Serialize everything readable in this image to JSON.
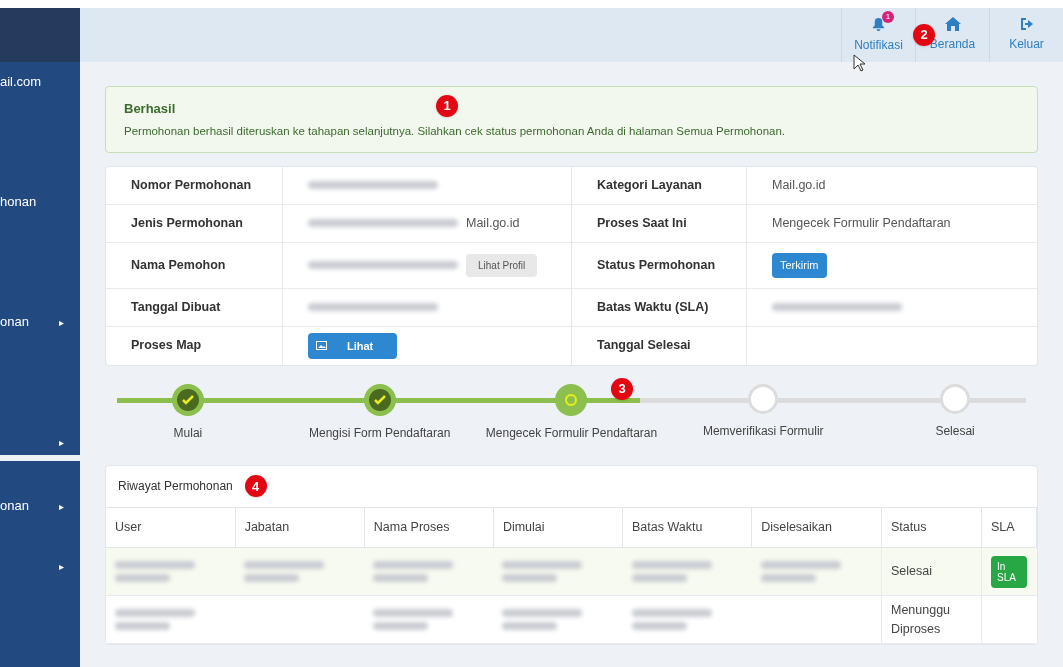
{
  "sidebar": {
    "items": [
      {
        "label": "ail.com",
        "arrow": false
      },
      {
        "label": "honan",
        "arrow": false
      },
      {
        "label": "onan",
        "arrow": true
      },
      {
        "arrow": true
      }
    ],
    "lower_items": [
      {
        "label": "onan",
        "arrow": true
      },
      {
        "arrow": true
      }
    ],
    "arrow_glyph": "▸"
  },
  "header": {
    "actions": [
      {
        "label": "Notifikasi",
        "kind": "bell",
        "badge": "1"
      },
      {
        "label": "Beranda",
        "kind": "home"
      },
      {
        "label": "Keluar",
        "kind": "logout"
      }
    ]
  },
  "alert": {
    "title": "Berhasil",
    "message": "Permohonan berhasil diteruskan ke tahapan selanjutnya. Silahkan cek status permohonan Anda di halaman Semua Permohonan."
  },
  "details": {
    "left": [
      {
        "label": "Nomor Permohonan",
        "kind": "blurred"
      },
      {
        "label": "Jenis Permohonan",
        "kind": "blurred_text",
        "value": "Mail.go.id"
      },
      {
        "label": "Nama Pemohon",
        "kind": "blurred_button",
        "button": "Lihat Profil"
      },
      {
        "label": "Tanggal Dibuat",
        "kind": "blurred"
      },
      {
        "label": "Proses Map",
        "kind": "image_button",
        "button": "Lihat"
      }
    ],
    "right": [
      {
        "label": "Kategori Layanan",
        "kind": "text",
        "value": "Mail.go.id"
      },
      {
        "label": "Proses Saat Ini",
        "kind": "text",
        "value": "Mengecek Formulir Pendaftaran"
      },
      {
        "label": "Status Permohonan",
        "kind": "badge",
        "value": "Terkirim"
      },
      {
        "label": "Batas Waktu (SLA)",
        "kind": "blurred"
      },
      {
        "label": "Tanggal Selesai",
        "kind": "empty"
      }
    ]
  },
  "steps": [
    {
      "label": "Mulai",
      "done": true,
      "current": false
    },
    {
      "label": "Mengisi Form Pendaftaran",
      "done": true,
      "current": false
    },
    {
      "label": "Mengecek Formulir Pendaftaran",
      "done": false,
      "current": true
    },
    {
      "label": "Memverifikasi Formulir",
      "done": false,
      "current": false
    },
    {
      "label": "Selesai",
      "done": false,
      "current": false
    }
  ],
  "history": {
    "title": "Riwayat Permohonan",
    "columns": [
      "User",
      "Jabatan",
      "Nama Proses",
      "Dimulai",
      "Batas Waktu",
      "Diselesaikan",
      "Status",
      "SLA"
    ],
    "rows": [
      {
        "highlight": true,
        "cells": [
          true,
          true,
          true,
          true,
          true,
          true
        ],
        "status": "Selesai",
        "sla": "In SLA"
      },
      {
        "highlight": false,
        "cells": [
          true,
          false,
          true,
          true,
          true,
          false
        ],
        "status": "Menunggu Diproses"
      }
    ]
  },
  "markers": [
    "1",
    "2",
    "3",
    "4"
  ]
}
